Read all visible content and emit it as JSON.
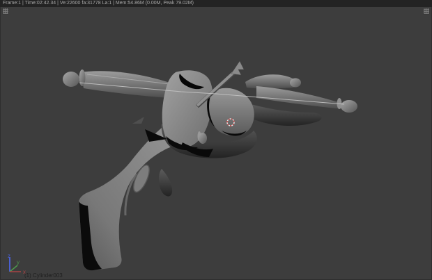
{
  "header": {
    "stats": "Frame:1 | Time:02:42.34 | Ve:22600 fa:31778 La:1 | Mem:54.86M (0.00M, Peak 79.02M)"
  },
  "viewport": {
    "object_label": "(1) Cylinder003",
    "model": "crossbow-3d-model"
  },
  "gizmo": {
    "x_label": "x",
    "y_label": "y",
    "z_label": "z",
    "x_color": "#a94444",
    "y_color": "#4d9a4d",
    "z_color": "#4a5fd0"
  },
  "colors": {
    "background": "#3d3d3d",
    "header_bg": "#232323",
    "header_text": "#a9a9a9",
    "object_label_text": "#1f1f1f",
    "cursor_red": "#d04b4b",
    "cursor_white": "#e8e8e8",
    "model_light": "#9d9d9d",
    "model_mid": "#7a7a7a",
    "model_dark": "#2a2a2a"
  },
  "icons": {
    "top_left": "corner-split-widget",
    "top_right": "corner-split-widget"
  }
}
